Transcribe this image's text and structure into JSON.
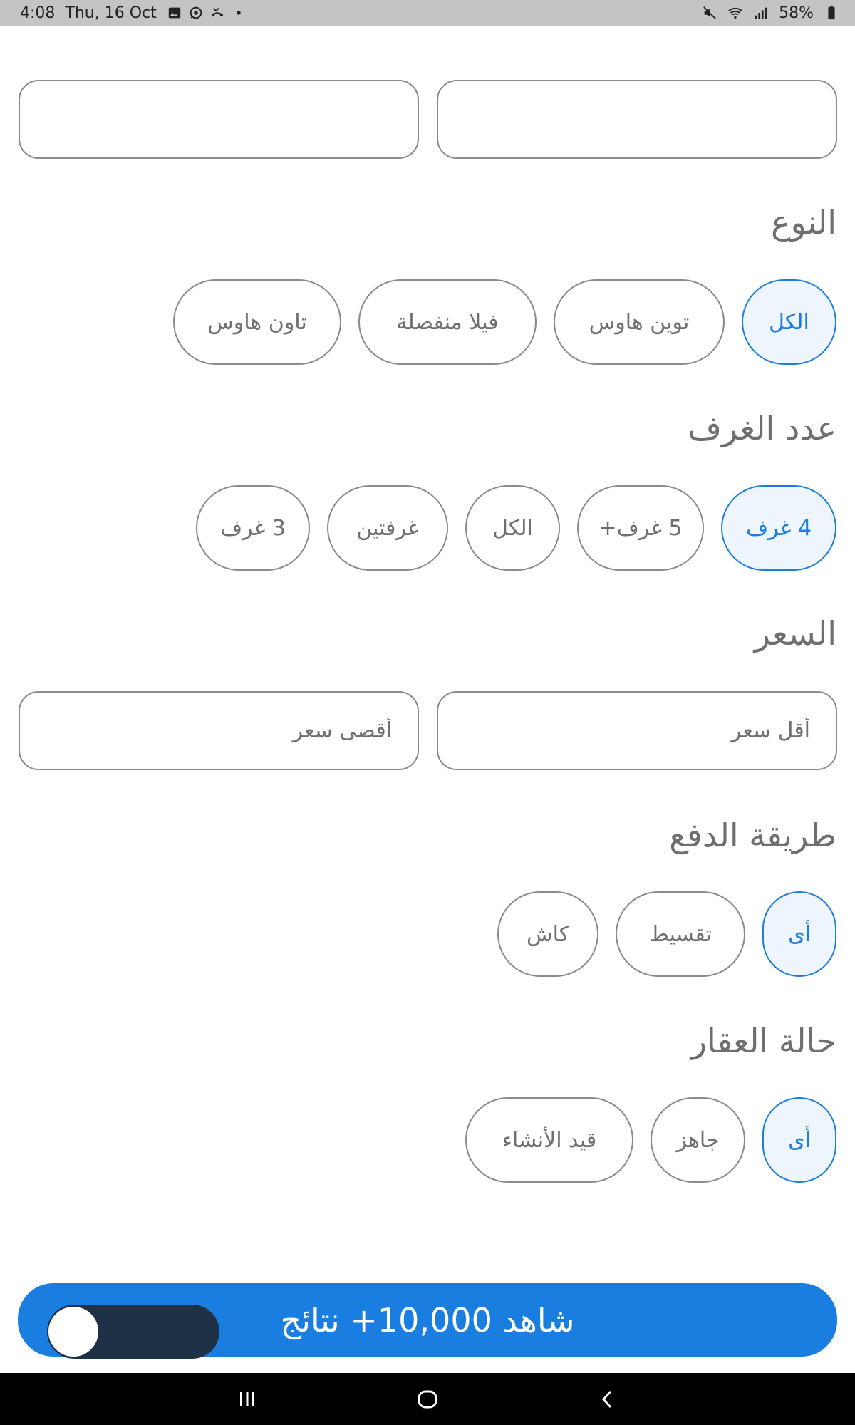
{
  "status_bar": {
    "time": "4:08",
    "date": "Thu, 16 Oct",
    "battery": "58%",
    "left_icons": [
      "gallery-icon",
      "whatsapp-icon",
      "missed-call-icon",
      "dot-icon"
    ],
    "right_icons": [
      "mute-icon",
      "wifi-icon",
      "signal-icon",
      "battery-icon"
    ]
  },
  "top_fields": [
    {
      "value": "",
      "placeholder": ""
    },
    {
      "value": "",
      "placeholder": ""
    }
  ],
  "type_section": {
    "title": "النوع",
    "options": [
      {
        "label": "الكل",
        "selected": true
      },
      {
        "label": "توين هاوس",
        "selected": false
      },
      {
        "label": "فيلا منفصلة",
        "selected": false
      },
      {
        "label": "تاون هاوس",
        "selected": false
      }
    ]
  },
  "rooms_section": {
    "title": "عدد الغرف",
    "options": [
      {
        "label": "4 غرف",
        "selected": true
      },
      {
        "label": "5 غرف+",
        "selected": false
      },
      {
        "label": "الكل",
        "selected": false
      },
      {
        "label": "غرفتين",
        "selected": false
      },
      {
        "label": "3 غرف",
        "selected": false
      }
    ]
  },
  "price_section": {
    "title": "السعر",
    "min_placeholder": "أقل سعر",
    "max_placeholder": "أقصى سعر"
  },
  "payment_section": {
    "title": "طريقة الدفع",
    "options": [
      {
        "label": "أى",
        "selected": true
      },
      {
        "label": "تقسيط",
        "selected": false
      },
      {
        "label": "كاش",
        "selected": false
      }
    ]
  },
  "status_section": {
    "title": "حالة العقار",
    "options": [
      {
        "label": "أى",
        "selected": true
      },
      {
        "label": "جاهز",
        "selected": false
      },
      {
        "label": "قيد الأنشاء",
        "selected": false
      }
    ]
  },
  "cta": {
    "label": "شاهد 10,000+ نتائج"
  },
  "colors": {
    "accent": "#1a7ee0",
    "chip_border": "#8a8a8a",
    "text": "#6f6f6f",
    "overlay": "#1f3147"
  }
}
